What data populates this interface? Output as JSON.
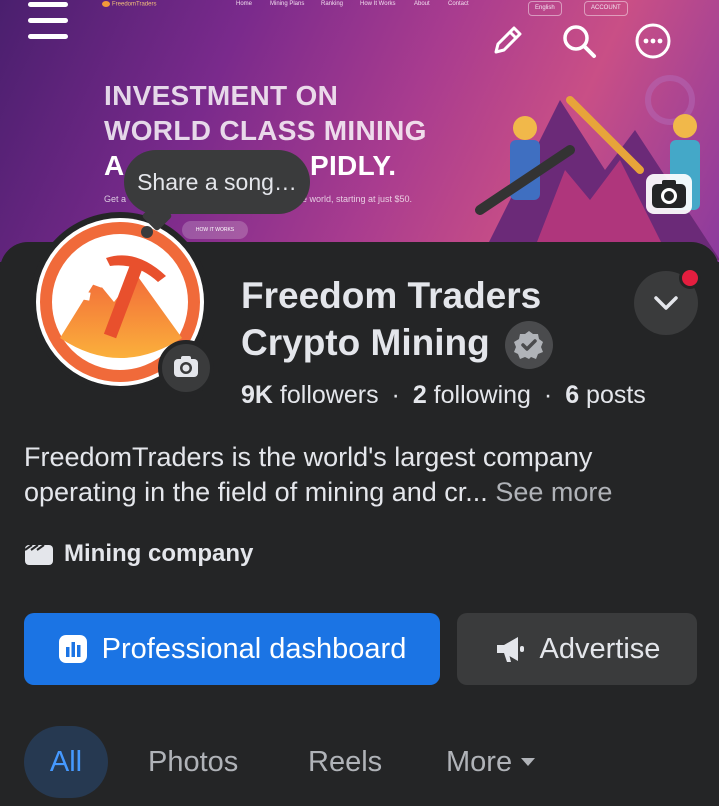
{
  "cover": {
    "site_logo": "FreedomTraders",
    "nav_items": [
      "Home",
      "Mining Plans",
      "Ranking",
      "How It Works",
      "About",
      "Contact"
    ],
    "lang": "English",
    "account": "ACCOUNT",
    "hero_line1": "INVESTMENT ON",
    "hero_line2": "WORLD CLASS MINING",
    "hero_line3_start": "A",
    "hero_line3_end": "PIDLY.",
    "hero_sub_start": "Get a",
    "hero_sub_end": "e world, starting at just $50.",
    "hero_button": "HOW IT WORKS"
  },
  "header_icons": [
    "menu-icon",
    "edit-pencil-icon",
    "search-icon",
    "more-options-icon"
  ],
  "song_bubble": "Share a song…",
  "page": {
    "title_line1": "Freedom Traders",
    "title_line2": "Crypto Mining",
    "verified": "verified-badge-icon"
  },
  "stats": {
    "followers_count": "9K",
    "followers_label": "followers",
    "following_count": "2",
    "following_label": "following",
    "posts_count": "6",
    "posts_label": "posts",
    "separator": "·"
  },
  "bio": {
    "text": "FreedomTraders is the world's largest company operating in the field of mining and cr...",
    "see_more": "See more"
  },
  "category": "Mining company",
  "buttons": {
    "dashboard": "Professional dashboard",
    "advertise": "Advertise"
  },
  "tabs": [
    "All",
    "Photos",
    "Reels",
    "More"
  ],
  "colors": {
    "background": "#242526",
    "primary": "#1b74e4",
    "secondary_button": "#3a3b3c",
    "active_tab_bg": "#263951",
    "active_tab_text": "#4599ff",
    "notification": "#e41e3f"
  }
}
